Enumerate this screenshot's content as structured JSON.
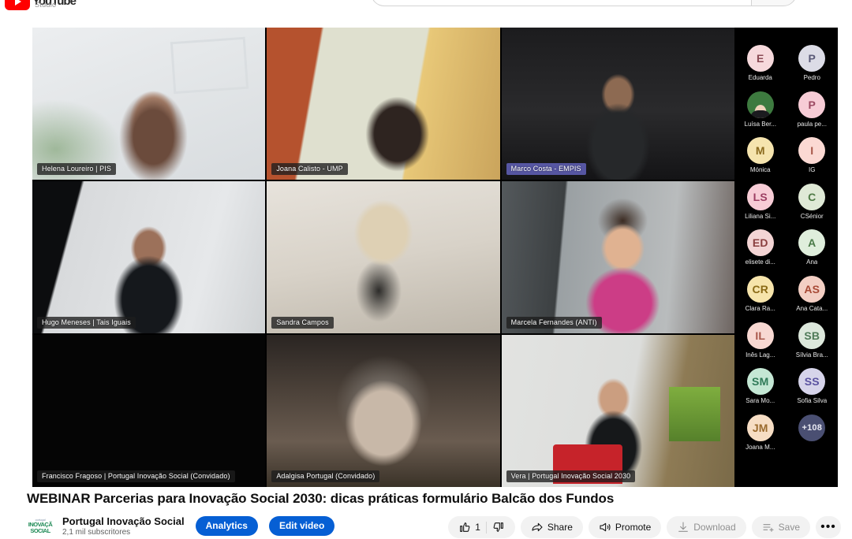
{
  "masthead": {
    "logo_text": "YouTube",
    "studio_label": "Studio",
    "search_placeholder": "",
    "search_value": "",
    "search_icon": "search-icon"
  },
  "player": {
    "layout": "3x3 grid gallery view",
    "tiles": [
      {
        "id": "helena",
        "name": "Helena Loureiro | PIS",
        "speaking": false
      },
      {
        "id": "joana",
        "name": "Joana Calisto - UMP",
        "speaking": false
      },
      {
        "id": "marco",
        "name": "Marco Costa - EMPIS",
        "speaking": true
      },
      {
        "id": "hugo",
        "name": "Hugo Meneses | Tais Iguais",
        "speaking": false
      },
      {
        "id": "sandra",
        "name": "Sandra Campos",
        "speaking": false
      },
      {
        "id": "marcela",
        "name": "Marcela Fernandes (ANTI)",
        "speaking": false
      },
      {
        "id": "francisco",
        "name": "Francisco Fragoso | Portugal Inovação Social (Convidado)",
        "speaking": false
      },
      {
        "id": "adalgisa",
        "name": "Adalgisa Portugal (Convidado)",
        "speaking": false
      },
      {
        "id": "vera",
        "name": "Vera | Portugal Inovação Social 2030",
        "speaking": false
      }
    ],
    "participants": [
      {
        "initials": "E",
        "name": "Eduarda",
        "bg": "#f6d9dc",
        "fg": "#8a4a54",
        "type": "initials"
      },
      {
        "initials": "P",
        "name": "Pedro",
        "bg": "#dcdce6",
        "fg": "#5b5b78",
        "type": "initials"
      },
      {
        "initials": "",
        "name": "Luísa Ber...",
        "bg": "#3d7a3f",
        "fg": "#ffffff",
        "type": "photo"
      },
      {
        "initials": "P",
        "name": "paula pe...",
        "bg": "#f7ccd6",
        "fg": "#9c4a63",
        "type": "initials"
      },
      {
        "initials": "M",
        "name": "Mónica",
        "bg": "#f5e4ae",
        "fg": "#8a6a1e",
        "type": "initials"
      },
      {
        "initials": "I",
        "name": "IG",
        "bg": "#fbd9d3",
        "fg": "#a8584a",
        "type": "initials"
      },
      {
        "initials": "LS",
        "name": "Liliana Si...",
        "bg": "#f7ccd6",
        "fg": "#9c3f63",
        "type": "initials"
      },
      {
        "initials": "C",
        "name": "CSénior",
        "bg": "#dfe9d6",
        "fg": "#4f7a46",
        "type": "initials"
      },
      {
        "initials": "ED",
        "name": "elisete di...",
        "bg": "#f3d4d4",
        "fg": "#8a3f3f",
        "type": "initials"
      },
      {
        "initials": "A",
        "name": "Ana",
        "bg": "#dfeedc",
        "fg": "#4a7a48",
        "type": "initials"
      },
      {
        "initials": "CR",
        "name": "Clara Ra...",
        "bg": "#f6e4ab",
        "fg": "#8a6a16",
        "type": "initials"
      },
      {
        "initials": "AS",
        "name": "Ana Cata...",
        "bg": "#f3cfc4",
        "fg": "#a84a36",
        "type": "initials"
      },
      {
        "initials": "IL",
        "name": "Inês Lag...",
        "bg": "#f8d8d2",
        "fg": "#a8574a",
        "type": "initials"
      },
      {
        "initials": "SB",
        "name": "Sílvia Bra...",
        "bg": "#dde8dc",
        "fg": "#4f7a58",
        "type": "initials"
      },
      {
        "initials": "SM",
        "name": "Sara Mo...",
        "bg": "#c4e7d4",
        "fg": "#2f7a58",
        "type": "initials"
      },
      {
        "initials": "SS",
        "name": "Sofia Silva",
        "bg": "#d6d4ea",
        "fg": "#5a52a0",
        "type": "initials"
      },
      {
        "initials": "JM",
        "name": "Joana M...",
        "bg": "#f6ddc4",
        "fg": "#9a6a2e",
        "type": "initials"
      },
      {
        "initials": "+108",
        "name": "",
        "bg": "#4a4f72",
        "fg": "#e8e9f2",
        "type": "overflow"
      }
    ]
  },
  "meta": {
    "title": "WEBINAR Parcerias para Inovação Social 2030: dicas práticas formulário Balcão dos Fundos",
    "channel_logo_line1": "portugal",
    "channel_logo_line2": "INOVAÇÃ",
    "channel_logo_line3": "SOCIAL",
    "channel_name": "Portugal Inovação Social",
    "channel_subs": "2,1 mil subscritores",
    "analytics_label": "Analytics",
    "edit_video_label": "Edit video"
  },
  "actions": {
    "like_count": "1",
    "like_icon": "thumbs-up-icon",
    "dislike_icon": "thumbs-down-icon",
    "share_label": "Share",
    "share_icon": "share-arrow-icon",
    "promote_label": "Promote",
    "promote_icon": "megaphone-icon",
    "download_label": "Download",
    "download_icon": "download-arrow-icon",
    "save_label": "Save",
    "save_icon": "save-list-icon",
    "more_label": "•••",
    "more_icon": "more-horizontal-icon"
  },
  "colors": {
    "brand_red": "#ff0000",
    "accent_blue": "#065fd4",
    "speaking_purple": "#5c5caf",
    "player_black": "#000000",
    "chip_grey": "#f2f2f2"
  }
}
